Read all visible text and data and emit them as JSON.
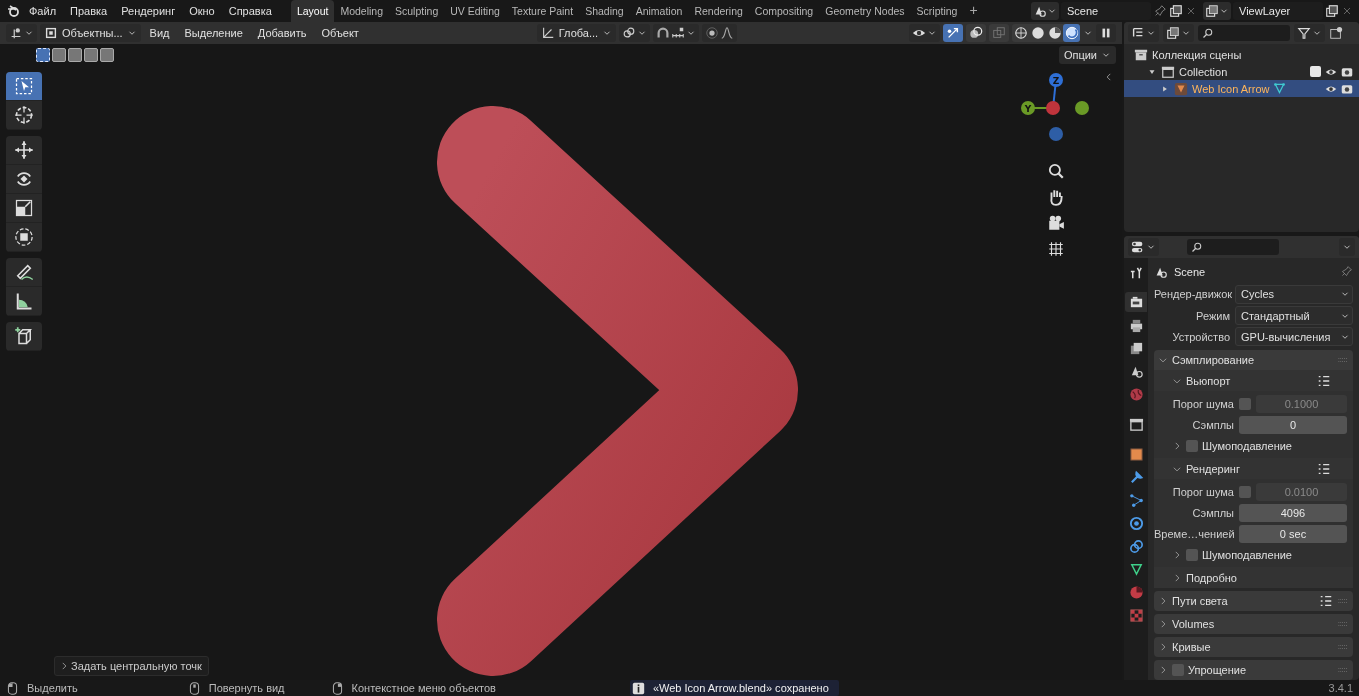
{
  "menu_bar": {
    "menus": [
      "Файл",
      "Правка",
      "Рендеринг",
      "Окно",
      "Справка"
    ],
    "workspaces": [
      {
        "label": "Layout",
        "selected": true
      },
      {
        "label": "Modeling",
        "selected": false
      },
      {
        "label": "Sculpting",
        "selected": false
      },
      {
        "label": "UV Editing",
        "selected": false
      },
      {
        "label": "Texture Paint",
        "selected": false
      },
      {
        "label": "Shading",
        "selected": false
      },
      {
        "label": "Animation",
        "selected": false
      },
      {
        "label": "Rendering",
        "selected": false
      },
      {
        "label": "Compositing",
        "selected": false
      },
      {
        "label": "Geometry Nodes",
        "selected": false
      },
      {
        "label": "Scripting",
        "selected": false
      }
    ],
    "add_tab": "+",
    "scene": "Scene",
    "view_layer": "ViewLayer"
  },
  "viewport_header": {
    "mode": "Объектны...",
    "menus": [
      "Вид",
      "Выделение",
      "Добавить",
      "Объект"
    ],
    "orientation": "Глоба...",
    "options": "Опции",
    "toggles": [
      {
        "kind": "gizmo",
        "on": true
      },
      {
        "kind": "overlays",
        "on": false
      },
      {
        "kind": "xray",
        "on": false
      }
    ],
    "shading_modes": [
      {
        "kind": "wireframe",
        "selected": false
      },
      {
        "kind": "solid",
        "selected": false
      },
      {
        "kind": "material",
        "selected": false
      },
      {
        "kind": "rendered",
        "selected": true
      }
    ]
  },
  "selection_modes": [
    {
      "selected": true
    },
    {
      "selected": false
    },
    {
      "selected": false
    },
    {
      "selected": false
    },
    {
      "selected": false
    }
  ],
  "tool_groups": [
    {
      "tools": [
        {
          "kind": "select",
          "selected": true
        },
        {
          "kind": "cursor",
          "selected": false
        }
      ]
    },
    {
      "tools": [
        {
          "kind": "move",
          "selected": false
        },
        {
          "kind": "rotate",
          "selected": false
        },
        {
          "kind": "scale",
          "selected": false
        },
        {
          "kind": "transform",
          "selected": false
        }
      ]
    },
    {
      "tools": [
        {
          "kind": "annotate",
          "selected": false
        },
        {
          "kind": "measure",
          "selected": false
        }
      ]
    },
    {
      "tools": [
        {
          "kind": "add_cube",
          "selected": false
        }
      ]
    }
  ],
  "gizmo_axes": [
    {
      "label": "Z",
      "color": "#2e6fd6"
    },
    {
      "label": "Y",
      "color": "#6a9a26"
    },
    {
      "color": "#c0343c"
    },
    {
      "color": "#6a9a26"
    },
    {
      "color": "#2e5ea6"
    }
  ],
  "last_operation": "Задать центральную точк",
  "outliner": {
    "items": [
      {
        "label": "Коллекция сцены",
        "kind": "scene_collection",
        "children": [
          {
            "label": "Collection",
            "kind": "collection",
            "expanded": true,
            "checked": true,
            "children": [
              {
                "label": "Web Icon Arrow",
                "kind": "object",
                "selected": true,
                "expanded": false
              }
            ]
          }
        ]
      }
    ]
  },
  "properties": {
    "tabs": [
      {
        "kind": "tool",
        "selected": false
      },
      {
        "kind": "render",
        "selected": true
      },
      {
        "kind": "output",
        "selected": false
      },
      {
        "kind": "view_layer",
        "selected": false
      },
      {
        "kind": "scene",
        "selected": false
      },
      {
        "kind": "world",
        "selected": false
      },
      {
        "kind": "collection",
        "selected": false
      },
      {
        "kind": "object",
        "selected": false
      },
      {
        "kind": "modifiers",
        "selected": false
      },
      {
        "kind": "particles",
        "selected": false
      },
      {
        "kind": "physics",
        "selected": false
      },
      {
        "kind": "constraints",
        "selected": false
      },
      {
        "kind": "data",
        "selected": false
      },
      {
        "kind": "material",
        "selected": false
      },
      {
        "kind": "texture",
        "selected": false
      }
    ],
    "context": "Scene",
    "fields": [
      {
        "label": "Рендер-движок",
        "value": "Cycles"
      },
      {
        "label": "Режим",
        "value": "Стандартный"
      },
      {
        "label": "Устройство",
        "value": "GPU-вычисления"
      }
    ],
    "panels": [
      {
        "title": "Сэмплирование",
        "expanded": true,
        "children": [
          {
            "kind": "subpanel",
            "title": "Вьюпорт",
            "expanded": true,
            "presets": true,
            "children": [
              {
                "kind": "check_number",
                "label": "Порог шума",
                "checked": false,
                "value": "0.1000"
              },
              {
                "kind": "number",
                "label": "Сэмплы",
                "value": "0"
              },
              {
                "kind": "subpanel",
                "title": "Шумоподавление",
                "expanded": false,
                "checked": false
              }
            ]
          },
          {
            "kind": "subpanel",
            "title": "Рендеринг",
            "expanded": true,
            "presets": true,
            "children": [
              {
                "kind": "check_number",
                "label": "Порог шума",
                "checked": false,
                "value": "0.0100"
              },
              {
                "kind": "number",
                "label": "Сэмплы",
                "value": "4096"
              },
              {
                "kind": "number",
                "label": "Време…ченией",
                "value": "0 sec"
              },
              {
                "kind": "subpanel",
                "title": "Шумоподавление",
                "expanded": false,
                "checked": false
              }
            ]
          },
          {
            "kind": "subpanel",
            "title": "Подробно",
            "expanded": false
          }
        ]
      },
      {
        "title": "Пути света",
        "expanded": false,
        "presets": true
      },
      {
        "title": "Volumes",
        "expanded": false
      },
      {
        "title": "Кривые",
        "expanded": false
      },
      {
        "title": "Упрощение",
        "expanded": false,
        "checked": false
      }
    ]
  },
  "status_bar": {
    "hints": [
      {
        "kind": "mouse_left",
        "label": "Выделить"
      },
      {
        "kind": "mouse_middle",
        "label": "Повернуть вид"
      },
      {
        "kind": "mouse_right",
        "label": "Контекстное меню объектов"
      }
    ],
    "report": "«Web Icon Arrow.blend» сохранено",
    "version": "3.4.1"
  }
}
